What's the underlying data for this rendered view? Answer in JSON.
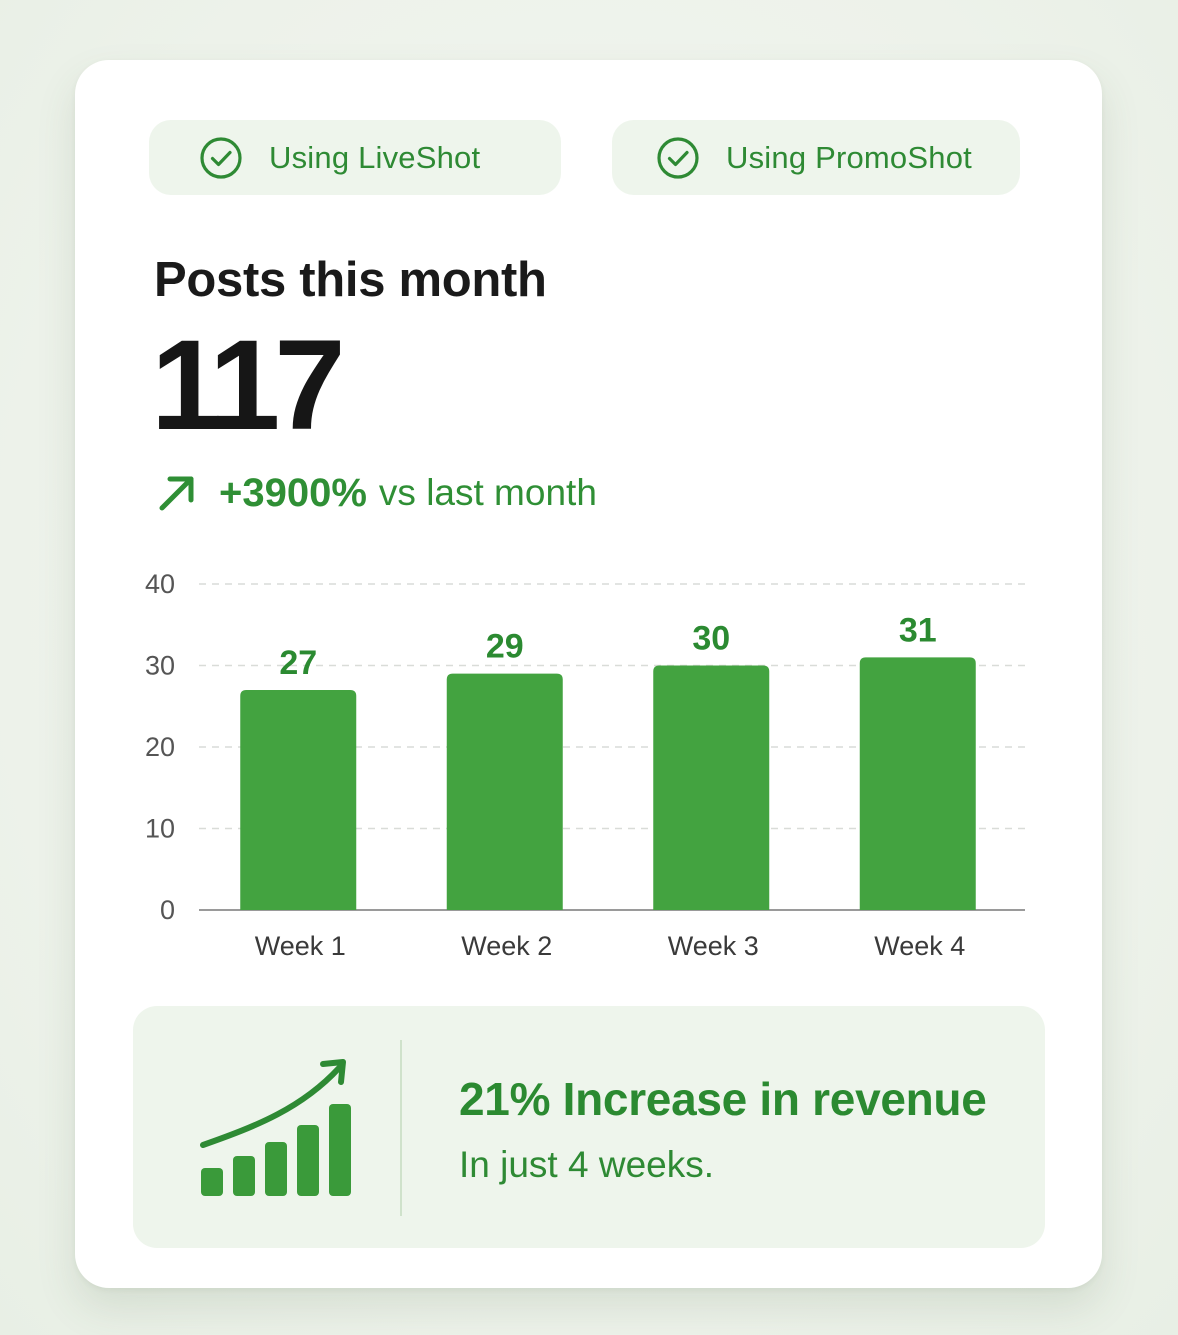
{
  "badges": [
    {
      "label": "Using LiveShot",
      "icon": "check-circle-icon"
    },
    {
      "label": "Using PromoShot",
      "icon": "check-circle-icon"
    }
  ],
  "stats": {
    "title": "Posts this month",
    "value": "117",
    "change_icon": "trend-up-arrow-icon",
    "change": "+3900%",
    "change_suffix": "vs last month"
  },
  "chart_data": {
    "type": "bar",
    "categories": [
      "Week 1",
      "Week 2",
      "Week 3",
      "Week 4"
    ],
    "values": [
      27,
      29,
      30,
      31
    ],
    "data_labels": [
      "27",
      "29",
      "30",
      "31"
    ],
    "title": "",
    "xlabel": "",
    "ylabel": "",
    "ylim": [
      0,
      40
    ],
    "yticks": [
      0,
      10,
      20,
      30,
      40
    ],
    "grid": true,
    "legend": "none",
    "bar_color": "#43a340",
    "label_color": "#2b8a31"
  },
  "summary": {
    "icon": "growth-chart-icon",
    "headline": "21% Increase in revenue",
    "subtext": "In just 4 weeks."
  },
  "colors": {
    "accent": "#2e8a34",
    "bar": "#43a340",
    "pill_bg": "#eef5ec",
    "card_bg": "#ffffff"
  }
}
